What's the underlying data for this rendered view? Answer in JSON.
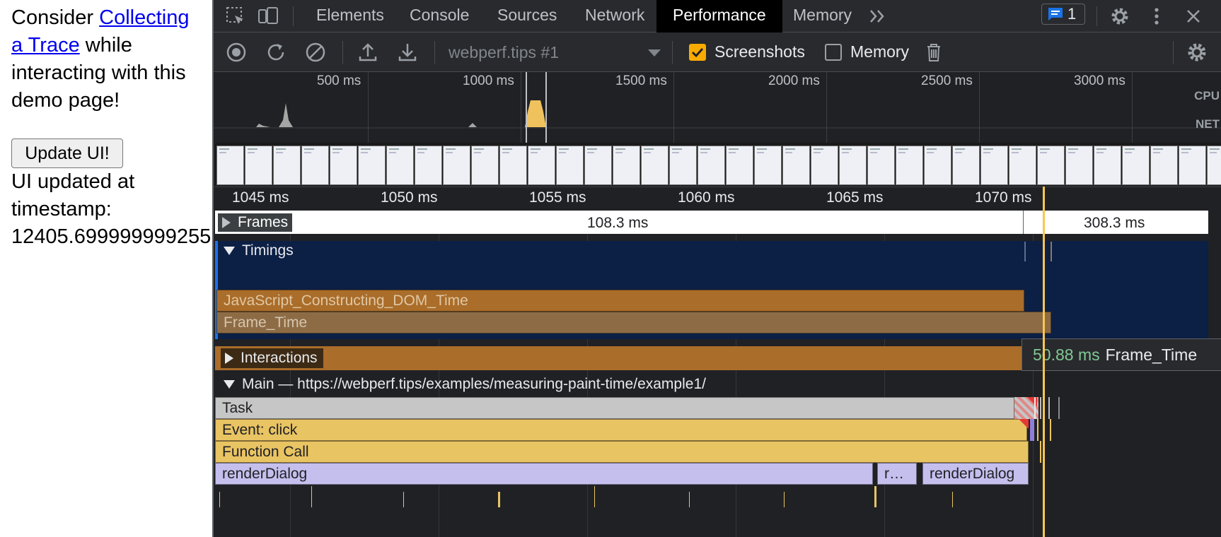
{
  "page": {
    "intro_before": "Consider ",
    "intro_link": "Collecting a Trace",
    "intro_after": " while interacting with this demo page!",
    "button": "Update UI!",
    "status_line1": "UI updated at",
    "status_line2": "timestamp:",
    "status_line3": "12405.699999999255"
  },
  "devtools": {
    "tabs": [
      "Elements",
      "Console",
      "Sources",
      "Network",
      "Performance",
      "Memory"
    ],
    "active_tab": "Performance",
    "issues_count": "1",
    "toolbar": {
      "target": "webperf.tips #1",
      "screenshots_label": "Screenshots",
      "screenshots_checked": true,
      "memory_label": "Memory",
      "memory_checked": false
    },
    "overview": {
      "ticks": [
        "500 ms",
        "1000 ms",
        "1500 ms",
        "2000 ms",
        "2500 ms",
        "3000 ms"
      ],
      "cpu_label": "CPU",
      "net_label": "NET"
    },
    "ruler": [
      "1045 ms",
      "1050 ms",
      "1055 ms",
      "1060 ms",
      "1065 ms",
      "1070 ms"
    ],
    "frames": {
      "label": "Frames",
      "values": [
        "108.3 ms",
        "308.3 ms"
      ]
    },
    "timings": {
      "label": "Timings",
      "bars": [
        "JavaScript_Constructing_DOM_Time",
        "Frame_Time"
      ]
    },
    "interactions_label": "Interactions",
    "main": {
      "label": "Main — https://webperf.tips/examples/measuring-paint-time/example1/",
      "task": "Task",
      "event": "Event: click",
      "function_call": "Function Call",
      "render1": "renderDialog",
      "render2": "r…",
      "render3": "renderDialog"
    },
    "tooltip": {
      "duration": "50.88 ms",
      "name": "Frame_Time"
    },
    "colors": {
      "task": "#c6c6c6",
      "event": "#e9c463",
      "render": "#c5bfee",
      "timing_js": "#aa6d2a",
      "timing_frame": "#8d6c45",
      "timings_bg": "#0c1f45",
      "checkbox": "#f9ab00"
    }
  }
}
